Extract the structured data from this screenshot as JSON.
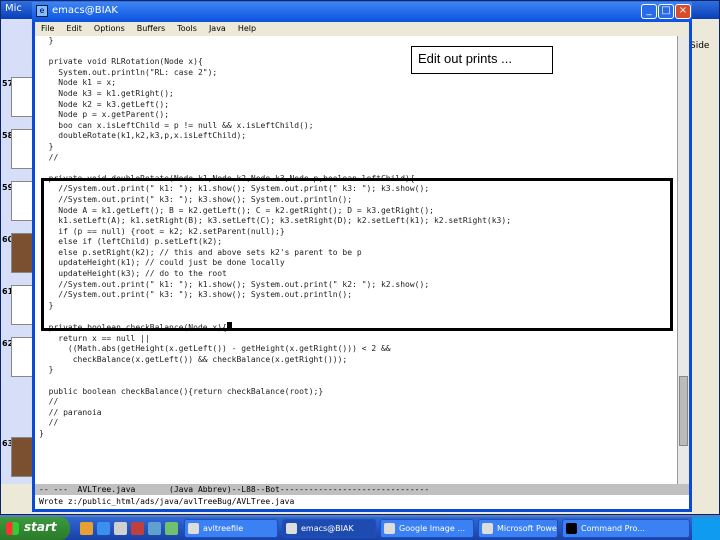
{
  "back_window": {
    "title": "Mic",
    "right_label": "Side",
    "slide_numbers": [
      "57",
      "58",
      "59",
      "60",
      "61",
      "62",
      "63"
    ]
  },
  "emacs": {
    "title": "emacs@BIAK",
    "menu": [
      "File",
      "Edit",
      "Options",
      "Buffers",
      "Tools",
      "Java",
      "Help"
    ],
    "code_lines": [
      "  }",
      "",
      "  private void RLRotation(Node x){",
      "    System.out.println(\"RL: case 2\");",
      "    Node k1 = x;",
      "    Node k3 = k1.getRight();",
      "    Node k2 = k3.getLeft();",
      "    Node p = x.getParent();",
      "    boo can x.isLeftChild = p != null && x.isLeftChild();",
      "    doubleRotate(k1,k2,k3,p,x.isLeftChild);",
      "  }",
      "  //",
      "",
      "  private void doubleRotate(Node k1,Node k2,Node k3,Node p,boolean leftChild){",
      "    //System.out.print(\" k1: \"); k1.show(); System.out.print(\" k3: \"); k3.show();",
      "    //System.out.print(\" k3: \"); k3.show(); System.out.println();",
      "    Node A = k1.getLeft(); B = k2.getLeft(); C = k2.getRight(); D = k3.getRight();",
      "    k1.setLeft(A); k1.setRight(B); k3.setLeft(C); k3.setRight(D); k2.setLeft(k1); k2.setRight(k3);",
      "    if (p == null) {root = k2; k2.setParent(null);}",
      "    else if (leftChild) p.setLeft(k2);",
      "    else p.setRight(k2); // this and above sets k2's parent to be p",
      "    updateHeight(k1); // could just be done locally",
      "    updateHeight(k3); // do to the root",
      "    //System.out.print(\" k1: \"); k1.show(); System.out.print(\" k2: \"); k2.show();",
      "    //System.out.print(\" k3: \"); k3.show(); System.out.println();",
      "  }",
      "",
      "  private boolean checkBalance(Node x){",
      "    return x == null ||",
      "      ((Math.abs(getHeight(x.getLeft()) - getHeight(x.getRight())) < 2 &&",
      "       checkBalance(x.getLeft()) && checkBalance(x.getRight()));",
      "  }",
      "",
      "  public boolean checkBalance(){return checkBalance(root);}",
      "  //",
      "  // paranoia",
      "  //",
      "}"
    ],
    "modeline": "-- ---  AVLTree.java       (Java Abbrev)--L88--Bot-------------------------------",
    "minibuffer": "Wrote z:/public_html/ads/java/avlTreeBug/AVLTree.java",
    "callout": "Edit out prints ..."
  },
  "taskbar": {
    "start_label": "start",
    "tasks": [
      "avltreefile",
      "emacs@BIAK",
      "Google Image ...",
      "Microsoft Power...",
      "Command Pro..."
    ]
  }
}
